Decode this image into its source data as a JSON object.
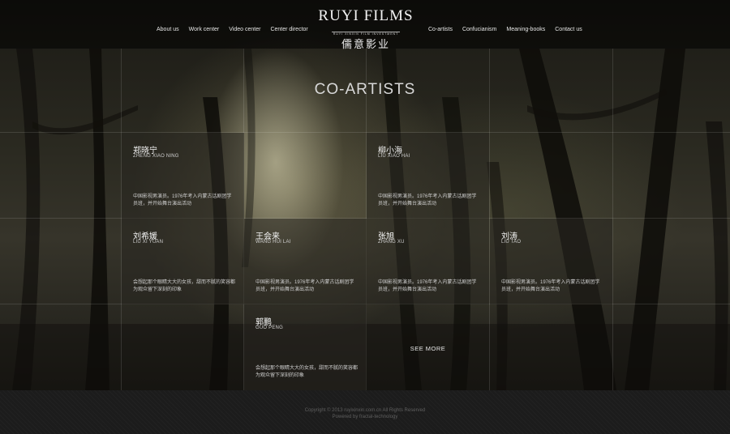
{
  "brand": {
    "name_en": "RUYI FILMS",
    "tagline": "RUYI XINXIN FILM INVESTMENT",
    "name_cn": "儒意影业"
  },
  "nav_left": [
    "About us",
    "Work center",
    "Video center",
    "Center director"
  ],
  "nav_right": [
    "Co-artists",
    "Confucianism",
    "Meaning-books",
    "Contact us"
  ],
  "section_title": "CO-ARTISTS",
  "artists": [
    {
      "cn": "郑晓宁",
      "py": "ZHENG XIAO NING",
      "desc": "中国影视男演员。1976年考入内蒙古话剧团学员班，并开始舞台演出活动"
    },
    {
      "cn": "柳小海",
      "py": "LIU XIAO HAI",
      "desc": "中国影视男演员。1976年考入内蒙古话剧团学员班，并开始舞台演出活动"
    },
    {
      "cn": "刘希媛",
      "py": "LIU XI YUAN",
      "desc": "会想起那个眼睛大大的女孩，甜而不腻的笑容都为观众留下深刻的印象"
    },
    {
      "cn": "王会来",
      "py": "WANG HUI LAI",
      "desc": "中国影视男演员。1976年考入内蒙古话剧团学员班，并开始舞台演出活动"
    },
    {
      "cn": "张旭",
      "py": "ZHANG XU",
      "desc": "中国影视男演员。1976年考入内蒙古话剧团学员班，并开始舞台演出活动"
    },
    {
      "cn": "刘涛",
      "py": "LIU TAO",
      "desc": "中国影视男演员。1976年考入内蒙古话剧团学员班，并开始舞台演出活动"
    },
    {
      "cn": "郭鹏",
      "py": "GUO PENG",
      "desc": "会想起那个眼睛大大的女孩，甜而不腻的笑容都为观众留下深刻的印象"
    }
  ],
  "see_more": "SEE MORE",
  "footer": {
    "copyright": "Copyright © 2013 ruyixinxin.com.cn All Rights Reserved",
    "powered": "Powered by fractal-technology"
  }
}
